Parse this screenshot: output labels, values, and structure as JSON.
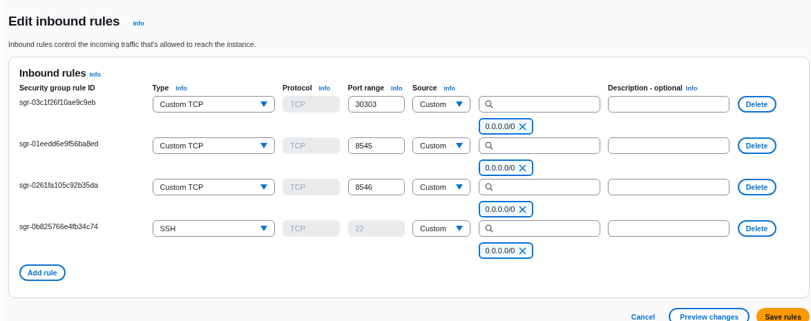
{
  "page": {
    "title": "Edit inbound rules",
    "title_info": "Info",
    "description": "Inbound rules control the incoming traffic that's allowed to reach the instance."
  },
  "panel": {
    "title": "Inbound rules",
    "title_info": "Info",
    "columns": [
      {
        "label": "Security group rule ID"
      },
      {
        "label": "Type",
        "info": "Info"
      },
      {
        "label": "Protocol",
        "info": "Info"
      },
      {
        "label": "Port range",
        "info": "Info"
      },
      {
        "label": "Source",
        "info": "Info"
      },
      {
        "label": "Description - optional",
        "info": "Info"
      }
    ],
    "rules": [
      {
        "id": "sgr-03c1f26f10ae9c9eb",
        "type": "Custom TCP",
        "protocol": "TCP",
        "port_range": "30303",
        "port_disabled": false,
        "source": "Custom",
        "cidr": "0.0.0.0/0",
        "delete": "Delete"
      },
      {
        "id": "sgr-01eedd6e9f56ba8ed",
        "type": "Custom TCP",
        "protocol": "TCP",
        "port_range": "8545",
        "port_disabled": false,
        "source": "Custom",
        "cidr": "0.0.0.0/0",
        "delete": "Delete"
      },
      {
        "id": "sgr-0261fa105c92b35da",
        "type": "Custom TCP",
        "protocol": "TCP",
        "port_range": "8546",
        "port_disabled": false,
        "source": "Custom",
        "cidr": "0.0.0.0/0",
        "delete": "Delete"
      },
      {
        "id": "sgr-0b825766e4fb34c74",
        "type": "SSH",
        "protocol": "TCP",
        "port_range": "22",
        "port_disabled": true,
        "source": "Custom",
        "cidr": "0.0.0.0/0",
        "delete": "Delete"
      }
    ],
    "add_button": "Add rule"
  },
  "footer": {
    "cancel": "Cancel",
    "preview": "Preview changes",
    "save": "Save rules"
  }
}
